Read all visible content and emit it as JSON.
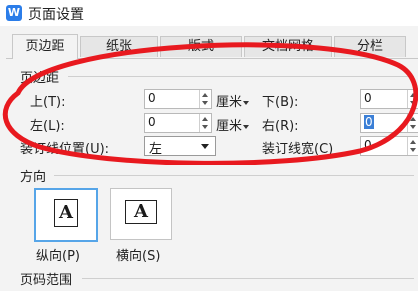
{
  "window": {
    "app_icon_letter": "W",
    "title": "页面设置"
  },
  "tabs": [
    {
      "label": "页边距",
      "active": true
    },
    {
      "label": "纸张",
      "active": false
    },
    {
      "label": "版式",
      "active": false
    },
    {
      "label": "文档网格",
      "active": false
    },
    {
      "label": "分栏",
      "active": false
    }
  ],
  "margins": {
    "section_title": "页边距",
    "top": {
      "label": "上(T):",
      "value": "0",
      "unit": "厘米"
    },
    "bottom": {
      "label": "下(B):",
      "value": "0"
    },
    "left": {
      "label": "左(L):",
      "value": "0",
      "unit": "厘米"
    },
    "right": {
      "label": "右(R):",
      "value": "0"
    },
    "gutter_position": {
      "label": "装订线位置(U):",
      "value": "左"
    },
    "gutter_width": {
      "label": "装订线宽(C)",
      "value": "0"
    }
  },
  "orientation": {
    "section_title": "方向",
    "portrait": {
      "glyph": "A",
      "label": "纵向(P)",
      "selected": true
    },
    "landscape": {
      "glyph": "A",
      "label": "横向(S)",
      "selected": false
    }
  },
  "page_range": {
    "section_title": "页码范围"
  },
  "colors": {
    "annotation_ellipse": "#e8191f",
    "selection_blue": "#56a5e8",
    "app_icon": "#2b7de9"
  }
}
